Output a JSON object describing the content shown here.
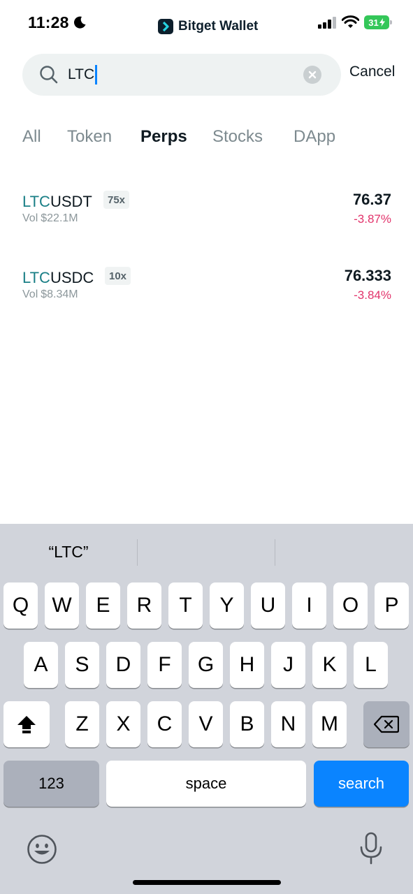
{
  "status_bar": {
    "time": "11:28",
    "brand": "Bitget Wallet",
    "battery": "31"
  },
  "search": {
    "value": "LTC",
    "cancel_label": "Cancel"
  },
  "tabs": [
    {
      "label": "All",
      "active": false
    },
    {
      "label": "Token",
      "active": false
    },
    {
      "label": "Perps",
      "active": true
    },
    {
      "label": "Stocks",
      "active": false
    },
    {
      "label": "DApp",
      "active": false
    }
  ],
  "results": [
    {
      "base": "LTC",
      "quote": "USDT",
      "leverage": "75x",
      "vol_label": "Vol",
      "vol_value": "$22.1M",
      "price": "76.37",
      "change": "-3.87%"
    },
    {
      "base": "LTC",
      "quote": "USDC",
      "leverage": "10x",
      "vol_label": "Vol",
      "vol_value": "$8.34M",
      "price": "76.333",
      "change": "-3.84%"
    }
  ],
  "keyboard": {
    "suggestion": "“LTC”",
    "row1": [
      "Q",
      "W",
      "E",
      "R",
      "T",
      "Y",
      "U",
      "I",
      "O",
      "P"
    ],
    "row2": [
      "A",
      "S",
      "D",
      "F",
      "G",
      "H",
      "J",
      "K",
      "L"
    ],
    "row3": [
      "Z",
      "X",
      "C",
      "V",
      "B",
      "N",
      "M"
    ],
    "numbers_label": "123",
    "space_label": "space",
    "search_label": "search"
  },
  "colors": {
    "accent_teal": "#1a7f86",
    "negative": "#e2336b",
    "keyboard_blue": "#0a84ff"
  }
}
